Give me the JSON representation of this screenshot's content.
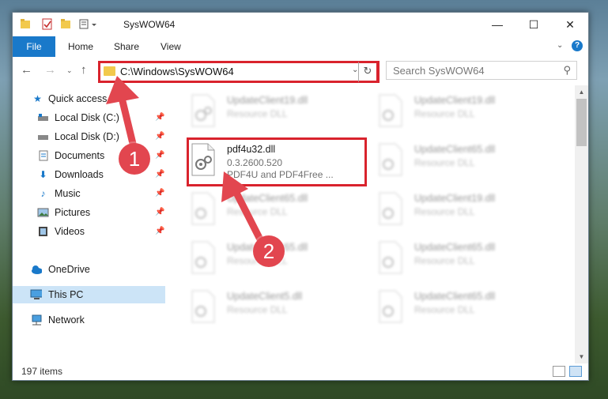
{
  "window": {
    "title": "SysWOW64",
    "controls": {
      "minimize": "—",
      "maximize": "☐",
      "close": "✕"
    }
  },
  "ribbon": {
    "tabs": [
      "File",
      "Home",
      "Share",
      "View"
    ]
  },
  "nav": {
    "address": "C:\\Windows\\SysWOW64",
    "search_placeholder": "Search SysWOW64"
  },
  "sidebar": {
    "items": [
      {
        "label": "Quick access",
        "icon": "star-icon",
        "pinned": false
      },
      {
        "label": "Local Disk (C:)",
        "icon": "drive-icon",
        "pinned": true
      },
      {
        "label": "Local Disk (D:)",
        "icon": "drive-icon",
        "pinned": true
      },
      {
        "label": "Documents",
        "icon": "documents-icon",
        "pinned": true
      },
      {
        "label": "Downloads",
        "icon": "download-icon",
        "pinned": true
      },
      {
        "label": "Music",
        "icon": "music-icon",
        "pinned": true
      },
      {
        "label": "Pictures",
        "icon": "pictures-icon",
        "pinned": true
      },
      {
        "label": "Videos",
        "icon": "video-icon",
        "pinned": true
      },
      {
        "label": "OneDrive",
        "icon": "cloud-icon",
        "pinned": false
      },
      {
        "label": "This PC",
        "icon": "computer-icon",
        "pinned": false,
        "selected": true
      },
      {
        "label": "Network",
        "icon": "network-icon",
        "pinned": false
      }
    ]
  },
  "files": {
    "left": [
      {
        "name": "UpdateClient19.dll",
        "type": "Resource DLL"
      },
      {
        "name": "pdf4u32.dll",
        "version": "0.3.2600.520",
        "description": "PDF4U and PDF4Free ..."
      },
      {
        "name": "UpdateClient65.dll",
        "type": "Resource DLL"
      },
      {
        "name": "UpdateClient65.dll",
        "type": "Resource DLL"
      },
      {
        "name": "UpdateClient5.dll",
        "type": "Resource DLL"
      }
    ],
    "right": [
      {
        "name": "UpdateClient19.dll",
        "type": "Resource DLL"
      },
      {
        "name": "UpdateClient65.dll",
        "type": "Resource DLL"
      },
      {
        "name": "UpdateClient19.dll",
        "type": "Resource DLL"
      },
      {
        "name": "UpdateClient65.dll",
        "type": "Resource DLL"
      },
      {
        "name": "UpdateClient65.dll",
        "type": "Resource DLL"
      }
    ]
  },
  "status": {
    "item_count": "197 items"
  },
  "annotations": {
    "step1": "1",
    "step2": "2",
    "color": "#e2464f"
  }
}
